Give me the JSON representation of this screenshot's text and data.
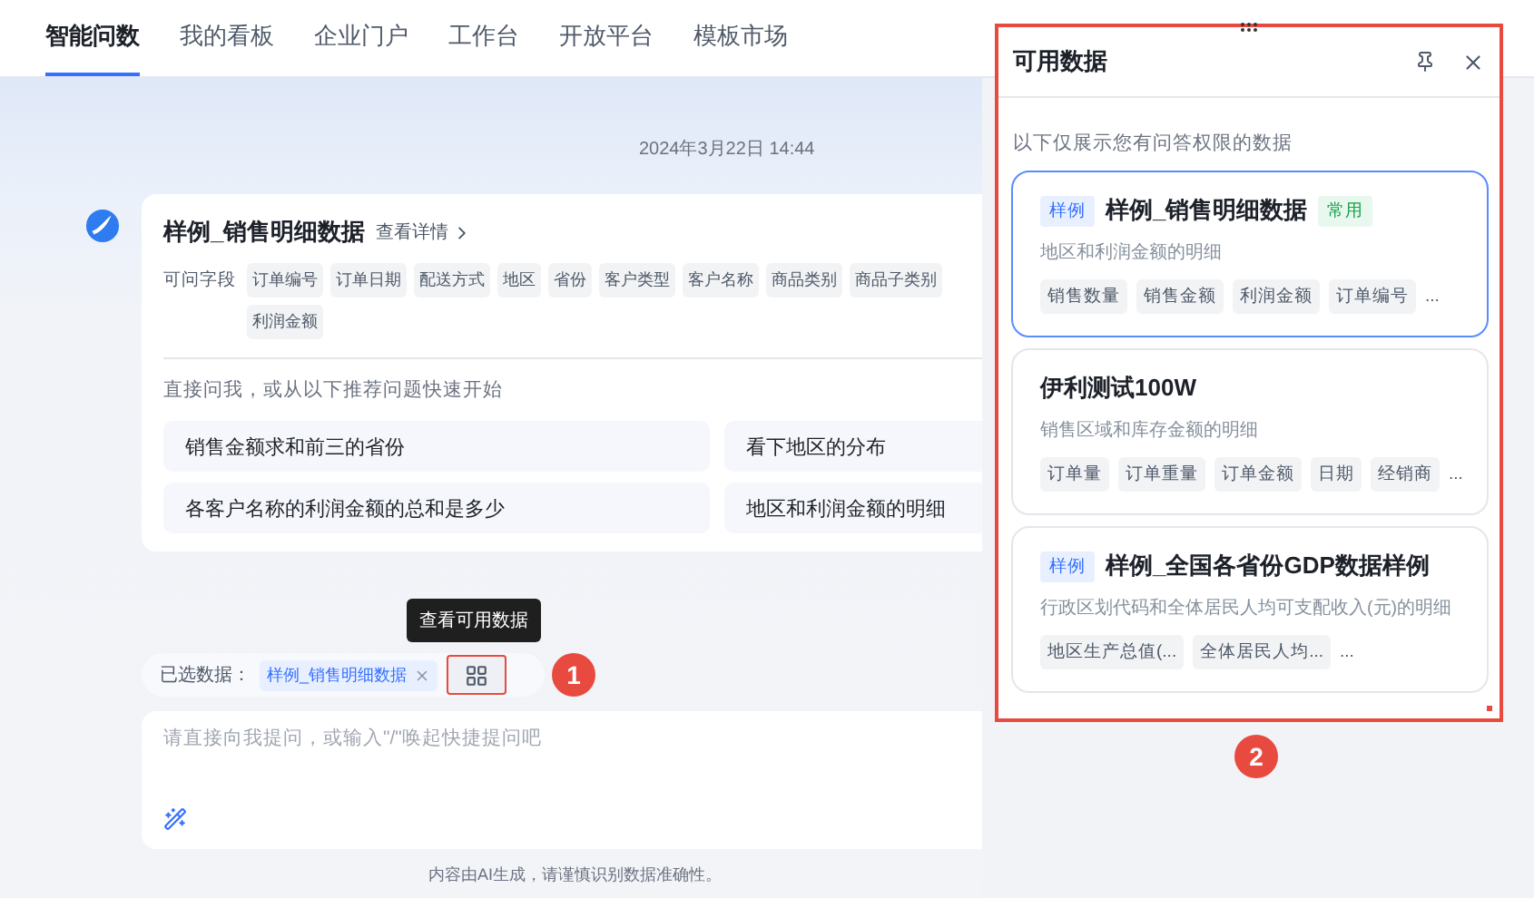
{
  "nav": {
    "tabs": [
      {
        "label": "智能问数",
        "selected": true
      },
      {
        "label": "我的看板",
        "selected": false
      },
      {
        "label": "企业门户",
        "selected": false
      },
      {
        "label": "工作台",
        "selected": false
      },
      {
        "label": "开放平台",
        "selected": false
      },
      {
        "label": "模板市场",
        "selected": false
      }
    ]
  },
  "timestamp": "2024年3月22日 14:44",
  "dataset_card": {
    "title": "样例_销售明细数据",
    "details_link": "查看详情",
    "fields_label": "可问字段",
    "field_rows": [
      [
        "订单编号",
        "订单日期",
        "配送方式",
        "地区",
        "省份",
        "客户类型",
        "客户名称",
        "商品类别",
        "商品子类别"
      ],
      [
        "利润金额"
      ]
    ],
    "prompt": "直接问我，或从以下推荐问题快速开始",
    "suggestions": [
      "销售金额求和前三的省份",
      "看下地区的分布",
      "各客户名称的利润金额的总和是多少",
      "地区和利润金额的明细"
    ]
  },
  "tooltip": "查看可用数据",
  "selected_data": {
    "label": "已选数据：",
    "chip": "样例_销售明细数据"
  },
  "input": {
    "placeholder": "请直接向我提问，或输入\"/\"唤起快捷提问吧"
  },
  "disclaimer": "内容由AI生成，请谨慎识别数据准确性。",
  "panel": {
    "title": "可用数据",
    "note": "以下仅展示您有问答权限的数据",
    "datasets": [
      {
        "tag": "样例",
        "name": "样例_销售明细数据",
        "badge": "常用",
        "selected": true,
        "description": "地区和利润金额的明细",
        "fields": [
          "销售数量",
          "销售金额",
          "利润金额",
          "订单编号"
        ],
        "more": "..."
      },
      {
        "name": "伊利测试100W",
        "selected": false,
        "description": "销售区域和库存金额的明细",
        "fields": [
          "订单量",
          "订单重量",
          "订单金额",
          "日期",
          "经销商"
        ],
        "more": "..."
      },
      {
        "tag": "样例",
        "name": "样例_全国各省份GDP数据样例",
        "selected": false,
        "description": "行政区划代码和全体居民人均可支配收入(元)的明细",
        "fields": [
          "地区生产总值(...",
          "全体居民人均..."
        ],
        "more": "..."
      }
    ]
  },
  "callouts": [
    "1",
    "2"
  ]
}
